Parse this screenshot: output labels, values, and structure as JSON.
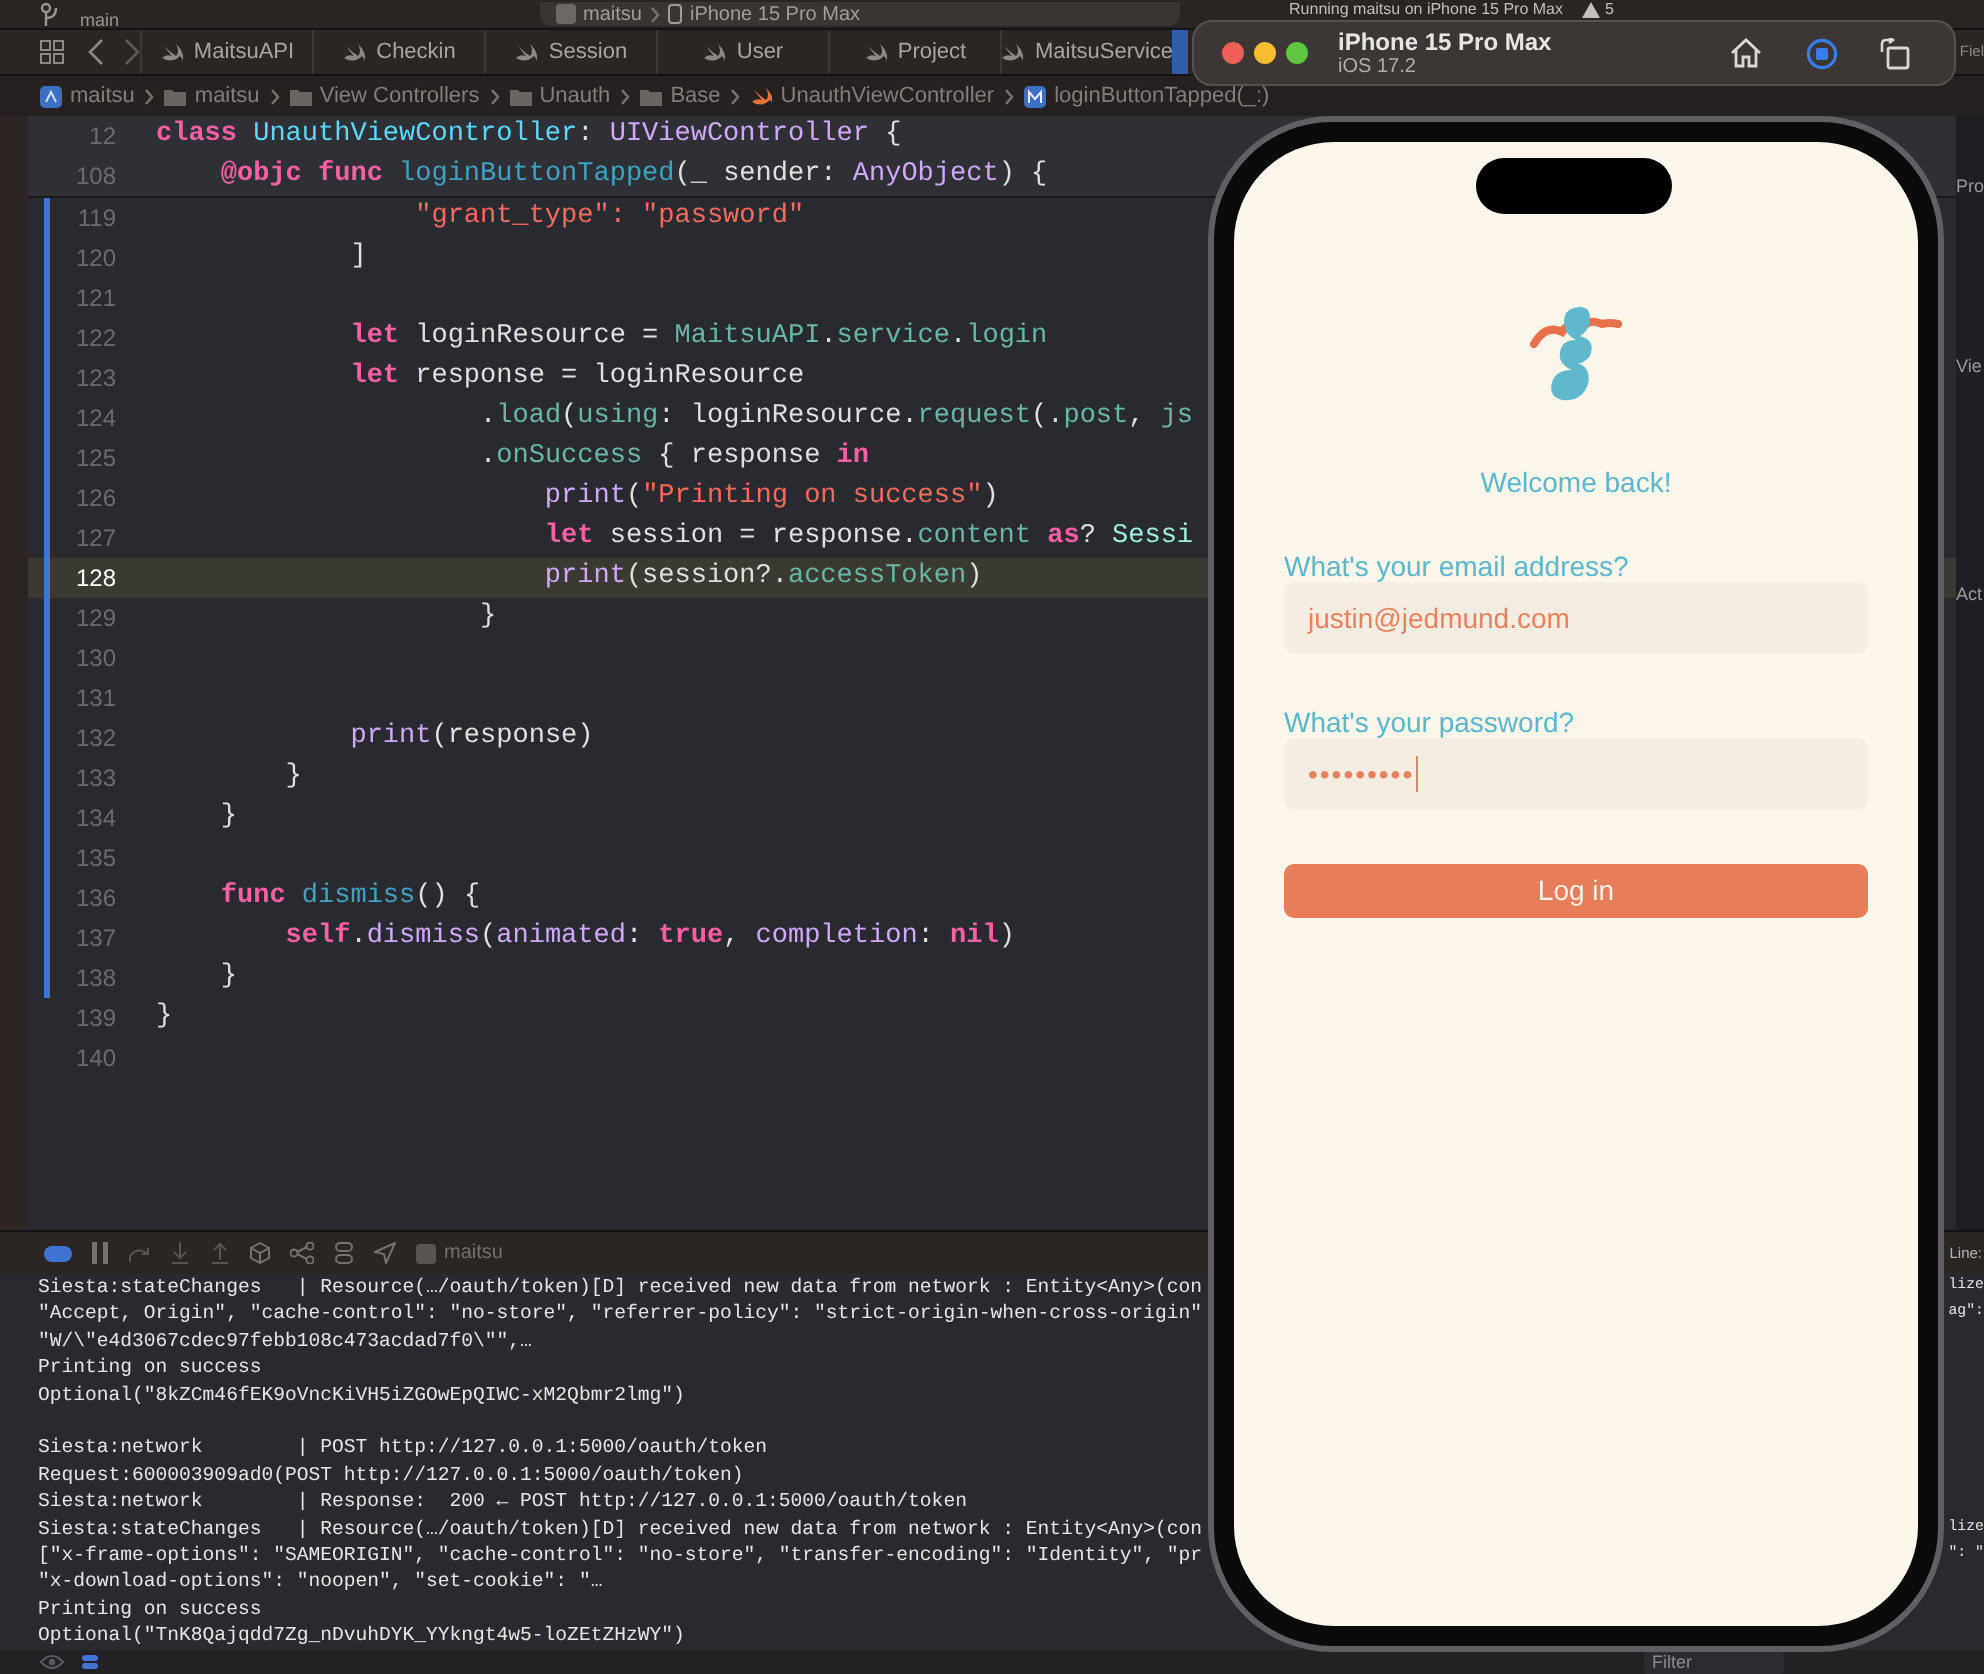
{
  "top_bar": {
    "branch": "main",
    "scheme": "maitsu",
    "destination": "iPhone 15 Pro Max",
    "activity": "Running maitsu on iPhone 15 Pro Max",
    "warnings": "5"
  },
  "tabs": [
    {
      "label": "MaitsuAPI"
    },
    {
      "label": "Checkin"
    },
    {
      "label": "Session"
    },
    {
      "label": "User"
    },
    {
      "label": "Project"
    },
    {
      "label": "MaitsuService"
    }
  ],
  "breadcrumb": [
    {
      "label": "maitsu",
      "kind": "project"
    },
    {
      "label": "maitsu",
      "kind": "folder"
    },
    {
      "label": "View Controllers",
      "kind": "folder"
    },
    {
      "label": "Unauth",
      "kind": "folder"
    },
    {
      "label": "Base",
      "kind": "folder"
    },
    {
      "label": "UnauthViewController",
      "kind": "swift"
    },
    {
      "label": "loginButtonTapped(_:)",
      "kind": "method"
    }
  ],
  "inspector": [
    "Fiel",
    "Pro",
    "Vie",
    "Act"
  ],
  "sticky_lines": [
    {
      "number": "12",
      "tokens": [
        {
          "text": "class ",
          "kind": "keyword"
        },
        {
          "text": "UnauthViewController",
          "kind": "type_decl"
        },
        {
          "text": ": ",
          "kind": "plain"
        },
        {
          "text": "UIViewController",
          "kind": "system"
        },
        {
          "text": " {",
          "kind": "plain"
        }
      ]
    },
    {
      "number": "108",
      "tokens": [
        {
          "text": "    @objc func ",
          "kind": "keyword"
        },
        {
          "text": "loginButtonTapped",
          "kind": "func_decl"
        },
        {
          "text": "(_ sender: ",
          "kind": "plain"
        },
        {
          "text": "AnyObject",
          "kind": "system"
        },
        {
          "text": ") {",
          "kind": "plain"
        }
      ]
    }
  ],
  "code_lines": [
    {
      "number": "119",
      "changed": true,
      "current": false,
      "tokens": [
        {
          "text": "                \"grant_type\": \"password\"",
          "kind": "string"
        }
      ]
    },
    {
      "number": "120",
      "changed": true,
      "current": false,
      "tokens": [
        {
          "text": "            ]",
          "kind": "plain"
        }
      ]
    },
    {
      "number": "121",
      "changed": true,
      "current": false
    },
    {
      "number": "122",
      "changed": true,
      "current": false,
      "tokens": [
        {
          "text": "            let",
          "kind": "keyword"
        },
        {
          "text": " loginResource = ",
          "kind": "plain"
        },
        {
          "text": "MaitsuAPI",
          "kind": "project"
        },
        {
          "text": ".",
          "kind": "plain"
        },
        {
          "text": "service",
          "kind": "project"
        },
        {
          "text": ".",
          "kind": "plain"
        },
        {
          "text": "login",
          "kind": "project"
        }
      ]
    },
    {
      "number": "123",
      "changed": true,
      "current": false,
      "tokens": [
        {
          "text": "            let",
          "kind": "keyword"
        },
        {
          "text": " response = loginResource",
          "kind": "plain"
        }
      ]
    },
    {
      "number": "124",
      "changed": true,
      "current": false,
      "tokens": [
        {
          "text": "                    .",
          "kind": "plain"
        },
        {
          "text": "load",
          "kind": "project"
        },
        {
          "text": "(",
          "kind": "plain"
        },
        {
          "text": "using",
          "kind": "project"
        },
        {
          "text": ": loginResource.",
          "kind": "plain"
        },
        {
          "text": "request",
          "kind": "project"
        },
        {
          "text": "(.",
          "kind": "plain"
        },
        {
          "text": "post",
          "kind": "project"
        },
        {
          "text": ", ",
          "kind": "plain"
        },
        {
          "text": "js",
          "kind": "project"
        }
      ]
    },
    {
      "number": "125",
      "changed": true,
      "current": false,
      "tokens": [
        {
          "text": "                    .",
          "kind": "plain"
        },
        {
          "text": "onSuccess",
          "kind": "project"
        },
        {
          "text": " { response ",
          "kind": "plain"
        },
        {
          "text": "in",
          "kind": "keyword"
        }
      ]
    },
    {
      "number": "126",
      "changed": true,
      "current": false,
      "tokens": [
        {
          "text": "                        print",
          "kind": "system"
        },
        {
          "text": "(",
          "kind": "plain"
        },
        {
          "text": "\"Printing on success\"",
          "kind": "string"
        },
        {
          "text": ")",
          "kind": "plain"
        }
      ]
    },
    {
      "number": "127",
      "changed": true,
      "current": false,
      "tokens": [
        {
          "text": "                        let",
          "kind": "keyword"
        },
        {
          "text": " session = response.",
          "kind": "plain"
        },
        {
          "text": "content",
          "kind": "project"
        },
        {
          "text": " as",
          "kind": "keyword"
        },
        {
          "text": "? ",
          "kind": "plain"
        },
        {
          "text": "Sessi",
          "kind": "project_type"
        }
      ]
    },
    {
      "number": "128",
      "changed": true,
      "current": true,
      "tokens": [
        {
          "text": "                        print",
          "kind": "system"
        },
        {
          "text": "(session?.",
          "kind": "plain"
        },
        {
          "text": "accessToken",
          "kind": "project"
        },
        {
          "text": ")",
          "kind": "plain"
        }
      ]
    },
    {
      "number": "129",
      "changed": true,
      "current": false,
      "tokens": [
        {
          "text": "                    }",
          "kind": "plain"
        }
      ]
    },
    {
      "number": "130",
      "changed": true,
      "current": false
    },
    {
      "number": "131",
      "changed": true,
      "current": false
    },
    {
      "number": "132",
      "changed": true,
      "current": false,
      "tokens": [
        {
          "text": "            print",
          "kind": "system"
        },
        {
          "text": "(response)",
          "kind": "plain"
        }
      ]
    },
    {
      "number": "133",
      "changed": true,
      "current": false,
      "tokens": [
        {
          "text": "        }",
          "kind": "plain"
        }
      ]
    },
    {
      "number": "134",
      "changed": true,
      "current": false,
      "tokens": [
        {
          "text": "    }",
          "kind": "plain"
        }
      ]
    },
    {
      "number": "135",
      "changed": true,
      "current": false
    },
    {
      "number": "136",
      "changed": true,
      "current": false,
      "tokens": [
        {
          "text": "    func ",
          "kind": "keyword"
        },
        {
          "text": "dismiss",
          "kind": "func_decl"
        },
        {
          "text": "() {",
          "kind": "plain"
        }
      ]
    },
    {
      "number": "137",
      "changed": true,
      "current": false,
      "tokens": [
        {
          "text": "        self",
          "kind": "keyword"
        },
        {
          "text": ".",
          "kind": "plain"
        },
        {
          "text": "dismiss",
          "kind": "system"
        },
        {
          "text": "(",
          "kind": "plain"
        },
        {
          "text": "animated",
          "kind": "system"
        },
        {
          "text": ": ",
          "kind": "plain"
        },
        {
          "text": "true",
          "kind": "keyword"
        },
        {
          "text": ", ",
          "kind": "plain"
        },
        {
          "text": "completion",
          "kind": "system"
        },
        {
          "text": ": ",
          "kind": "plain"
        },
        {
          "text": "nil",
          "kind": "keyword"
        },
        {
          "text": ")",
          "kind": "plain"
        }
      ]
    },
    {
      "number": "138",
      "changed": true,
      "current": false,
      "tokens": [
        {
          "text": "    }",
          "kind": "plain"
        }
      ]
    },
    {
      "number": "139",
      "changed": false,
      "current": false,
      "tokens": [
        {
          "text": "}",
          "kind": "plain"
        }
      ]
    },
    {
      "number": "140",
      "changed": false,
      "current": false
    }
  ],
  "debug_bar": {
    "target": "maitsu",
    "position_label": "Line:"
  },
  "console": [
    {
      "kind": "text",
      "text": "Siesta:stateChanges   | Resource(…/oauth/token)[D] received new data from network : Entity<Any>(con",
      "tail": "lize"
    },
    {
      "kind": "text",
      "text": "\"Accept, Origin\", \"cache-control\": \"no-store\", \"referrer-policy\": \"strict-origin-when-cross-origin\"",
      "tail": "ag\":"
    },
    {
      "kind": "text",
      "text": "\"W/\\\"e4d3067cdec97febb108c473acdad7f0\\\"\",…"
    },
    {
      "kind": "text",
      "text": "Printing on success"
    },
    {
      "kind": "text",
      "text": "Optional(\"8kZCm46fEK9oVncKiVH5iZGOwEpQIWC-xM2Qbmr2lmg\")"
    },
    {
      "kind": "gap"
    },
    {
      "kind": "text",
      "text": "Siesta:network        | POST http://127.0.0.1:5000/oauth/token"
    },
    {
      "kind": "text",
      "text": "Request:600003909ad0(POST http://127.0.0.1:5000/oauth/token)"
    },
    {
      "kind": "text",
      "text": "Siesta:network        | Response:  200 ← POST http://127.0.0.1:5000/oauth/token"
    },
    {
      "kind": "text",
      "text": "Siesta:stateChanges   | Resource(…/oauth/token)[D] received new data from network : Entity<Any>(con",
      "tail": "lize"
    },
    {
      "kind": "text",
      "text": "[\"x-frame-options\": \"SAMEORIGIN\", \"cache-control\": \"no-store\", \"transfer-encoding\": \"Identity\", \"pr",
      "tail": "\": \""
    },
    {
      "kind": "text",
      "text": "\"x-download-options\": \"noopen\", \"set-cookie\": \"…"
    },
    {
      "kind": "text",
      "text": "Printing on success"
    },
    {
      "kind": "text",
      "text": "Optional(\"TnK8Qajqdd7Zg_nDvuhDYK_YYkngt4w5-loZEtZHzWY\")"
    }
  ],
  "console_filter": {
    "placeholder": "Filter"
  },
  "simulator": {
    "device": "iPhone 15 Pro Max",
    "os": "iOS 17.2"
  },
  "app": {
    "welcome": "Welcome back!",
    "fields": [
      {
        "label": "What's your email address?",
        "value": "justin@jedmund.com",
        "focused": false
      },
      {
        "label": "What's your password?",
        "value": "•••••••••",
        "focused": true
      }
    ],
    "button": "Log in"
  }
}
